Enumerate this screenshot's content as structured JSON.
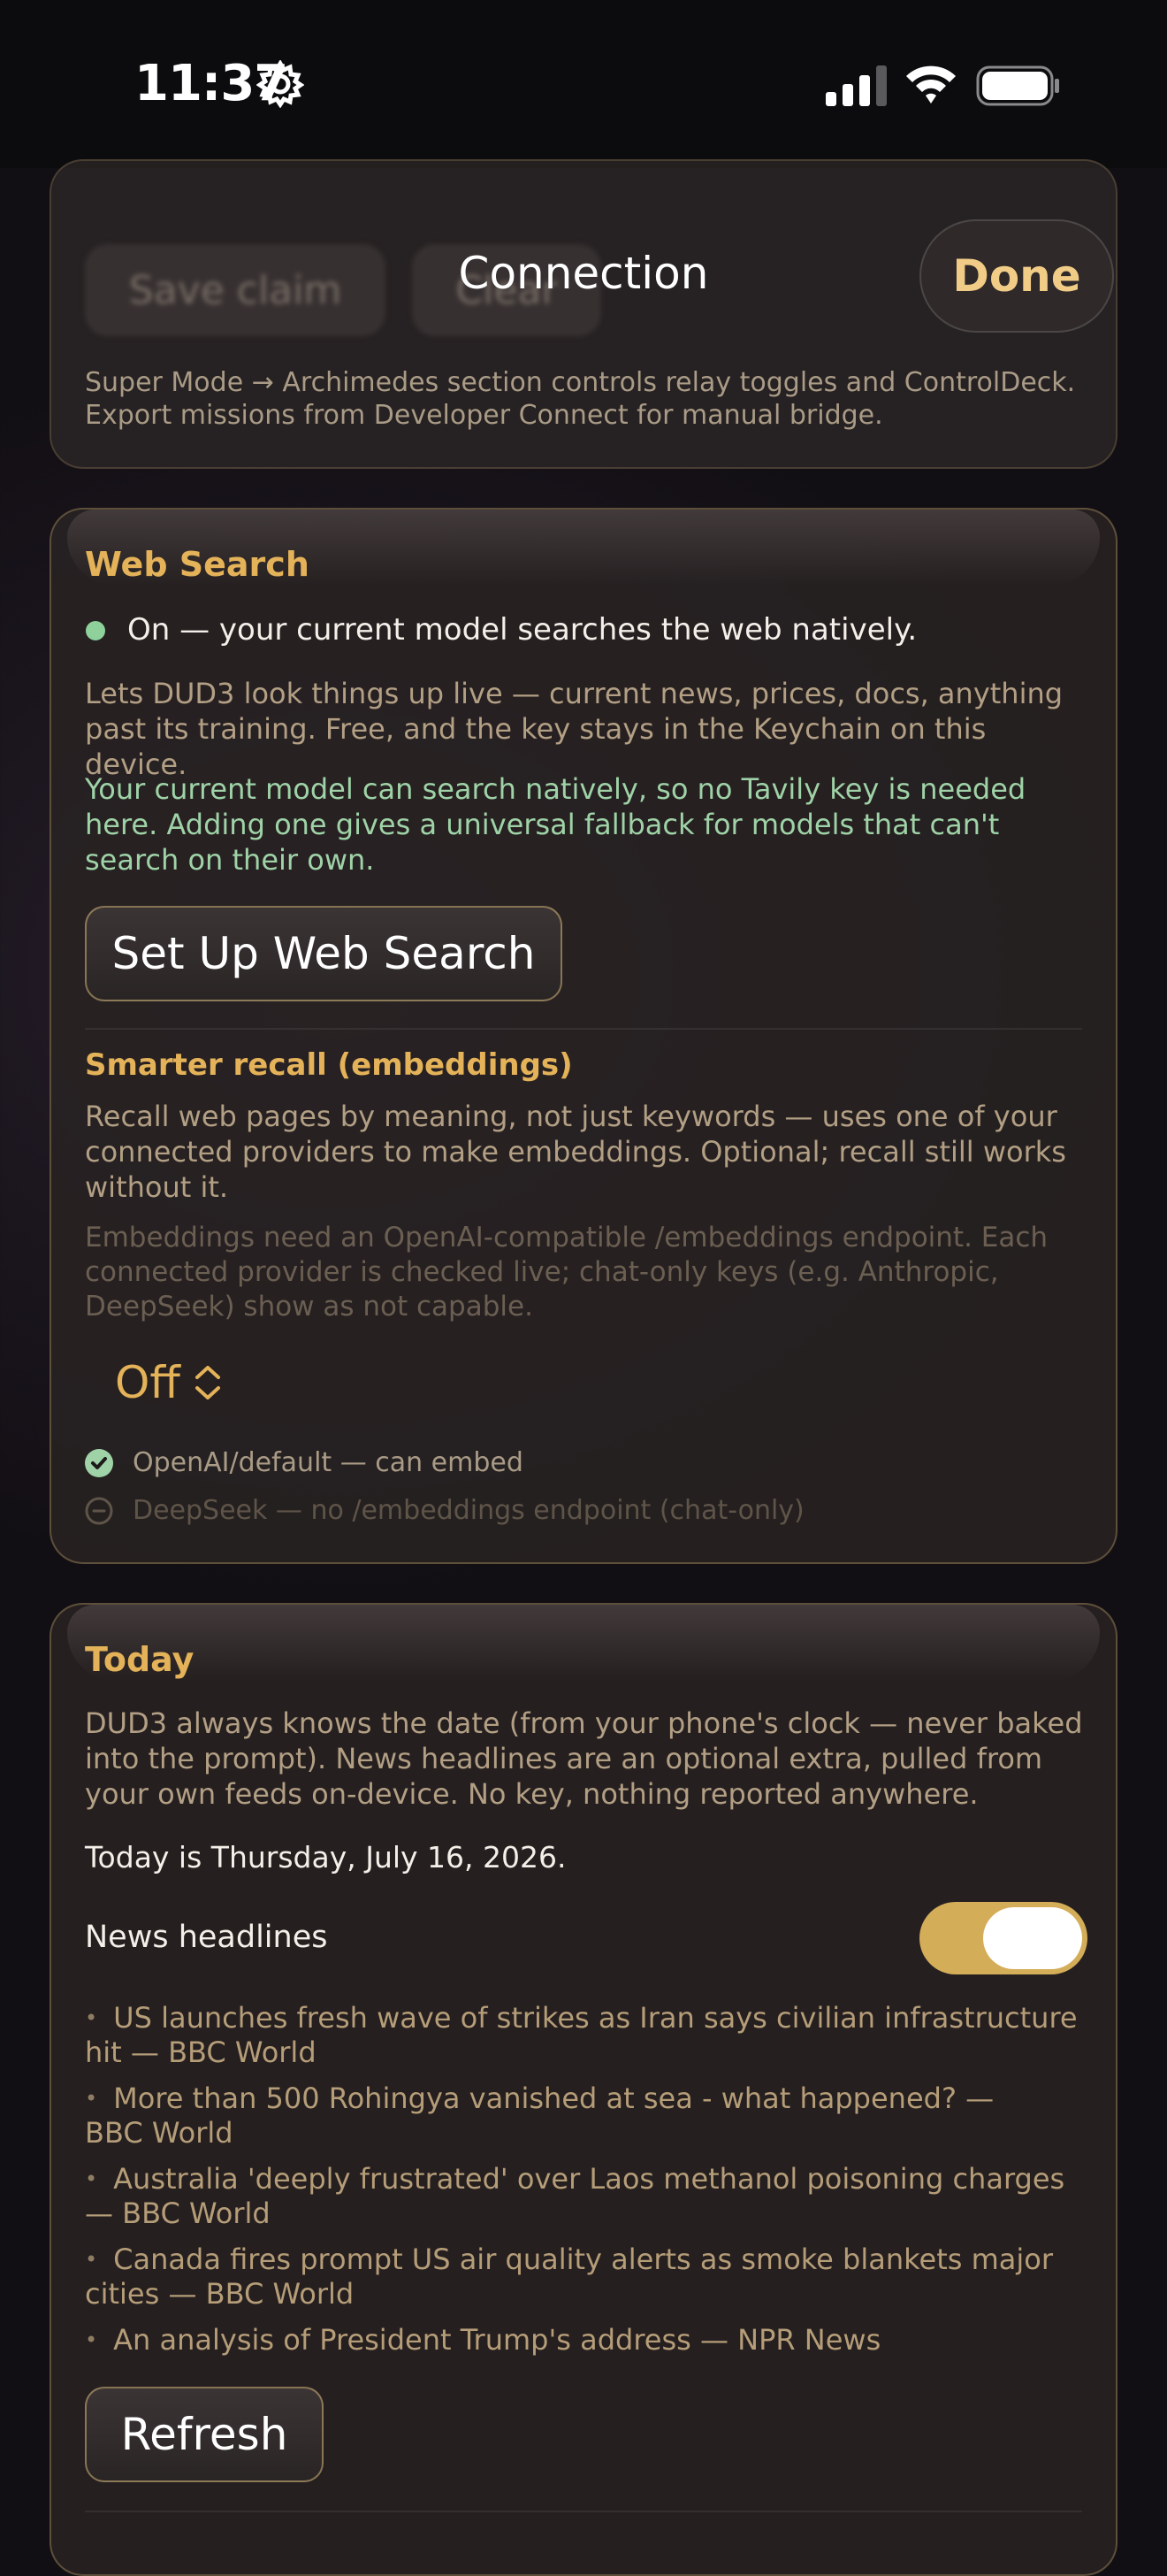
{
  "status_bar": {
    "time": "11:37"
  },
  "nav": {
    "title": "Connection",
    "done_label": "Done"
  },
  "top_card": {
    "save_claim_label": "Save claim",
    "clear_label": "Clear",
    "note": "Super Mode → Archimedes section controls relay toggles and ControlDeck. Export missions from Developer Connect for manual bridge."
  },
  "web_search": {
    "title": "Web Search",
    "status": "On — your current model searches the web natively.",
    "description": "Lets DUD3 look things up live — current news, prices, docs, anything past its training. Free, and the key stays in the Keychain on this device.",
    "native_note": "Your current model can search natively, so no Tavily key is needed here. Adding one gives a universal fallback for models that can't search on their own.",
    "setup_button": "Set Up Web Search",
    "recall": {
      "title": "Smarter recall (embeddings)",
      "description": "Recall web pages by meaning, not just keywords — uses one of your connected providers to make embeddings. Optional; recall still works without it.",
      "requirement": "Embeddings need an OpenAI-compatible /embeddings endpoint. Each connected provider is checked live; chat-only keys (e.g. Anthropic, DeepSeek) show as not capable.",
      "selected": "Off",
      "providers": [
        {
          "label": "OpenAI/default — can embed",
          "capable": true
        },
        {
          "label": "DeepSeek — no /embeddings endpoint (chat-only)",
          "capable": false
        }
      ]
    }
  },
  "today": {
    "title": "Today",
    "description": "DUD3 always knows the date (from your phone's clock — never baked into the prompt). News headlines are an optional extra, pulled from your own feeds on-device. No key, nothing reported anywhere.",
    "date_line": "Today is Thursday, July 16, 2026.",
    "news_label": "News headlines",
    "news_enabled": true,
    "headlines": [
      "US launches fresh wave of strikes as Iran says civilian infrastructure hit — BBC World",
      "More than 500 Rohingya vanished at sea - what happened? — BBC World",
      "Australia 'deeply frustrated' over Laos methanol poisoning charges — BBC World",
      "Canada fires prompt US air quality alerts as smoke blankets major cities — BBC World",
      "An analysis of President Trump's address — NPR News"
    ],
    "refresh_label": "Refresh"
  },
  "colors": {
    "accent": "#e4b258",
    "done_text": "#f0cc86",
    "toggle_on": "#d4ad58",
    "status_green": "#8fd19b"
  }
}
